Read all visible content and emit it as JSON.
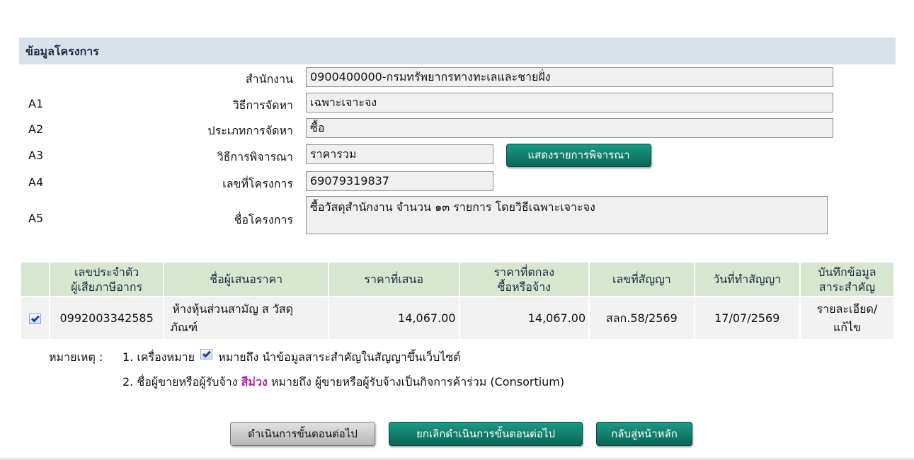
{
  "section": {
    "title": "ข้อมูลโครงการ"
  },
  "form": {
    "agency": {
      "code": "",
      "label": "สำนักงาน",
      "value": "0900400000-กรมทรัพยากรทางทะเลและชายฝั่ง"
    },
    "method": {
      "code": "A1",
      "label": "วิธีการจัดหา",
      "value": "เฉพาะเจาะจง"
    },
    "type": {
      "code": "A2",
      "label": "ประเภทการจัดหา",
      "value": "ซื้อ"
    },
    "criteria": {
      "code": "A3",
      "label": "วิธีการพิจารณา",
      "value": "ราคารวม",
      "button": "แสดงรายการพิจารณา"
    },
    "project_no": {
      "code": "A4",
      "label": "เลขที่โครงการ",
      "value": "69079319837"
    },
    "project_name": {
      "code": "A5",
      "label": "ชื่อโครงการ",
      "value": "ซื้อวัสดุสำนักงาน จำนวน ๑๓ รายการ โดยวิธีเฉพาะเจาะจง"
    }
  },
  "table": {
    "headers": {
      "tax_id_1": "เลขประจำตัว",
      "tax_id_2": "ผู้เสียภาษีอากร",
      "bidder": "ชื่อผู้เสนอราคา",
      "offer": "ราคาที่เสนอ",
      "agreed_1": "ราคาที่ตกลง",
      "agreed_2": "ซื้อหรือจ้าง",
      "contract_no": "เลขที่สัญญา",
      "contract_date": "วันที่ทำสัญญา",
      "record_1": "บันทึกข้อมูล",
      "record_2": "สาระสำคัญ"
    },
    "rows": [
      {
        "tax_id": "0992003342585",
        "bidder_1": "ห้างหุ้นส่วนสามัญ ส วัสดุ",
        "bidder_2": "ภัณฑ์",
        "offer": "14,067.00",
        "agreed": "14,067.00",
        "contract_no": "สลก.58/2569",
        "contract_date": "17/07/2569",
        "action_1": "รายละเอียด/",
        "action_2": "แก้ไข"
      }
    ]
  },
  "notes": {
    "label": "หมายเหตุ :",
    "n1_prefix": "1. เครื่องหมาย",
    "n1_suffix": "หมายถึง นำข้อมูลสาระสำคัญในสัญญาขึ้นเว็บไซต์",
    "n2_prefix": "2. ชื่อผู้ขายหรือผู้รับจ้าง",
    "n2_color": "สีม่วง",
    "n2_suffix": "หมายถึง ผู้ขายหรือผู้รับจ้างเป็นกิจการค้าร่วม (Consortium)"
  },
  "actions": {
    "next": "ดำเนินการขั้นตอนต่อไป",
    "cancel": "ยกเลิกดำเนินการขั้นตอนต่อไป",
    "home": "กลับสู่หน้าหลัก"
  },
  "colors": {
    "header_bg": "#d9e2ea",
    "table_header_bg": "#d6e6cf",
    "button_green": "#0b6656",
    "consortium_purple": "#b4209e",
    "link": "#6a84a0"
  }
}
